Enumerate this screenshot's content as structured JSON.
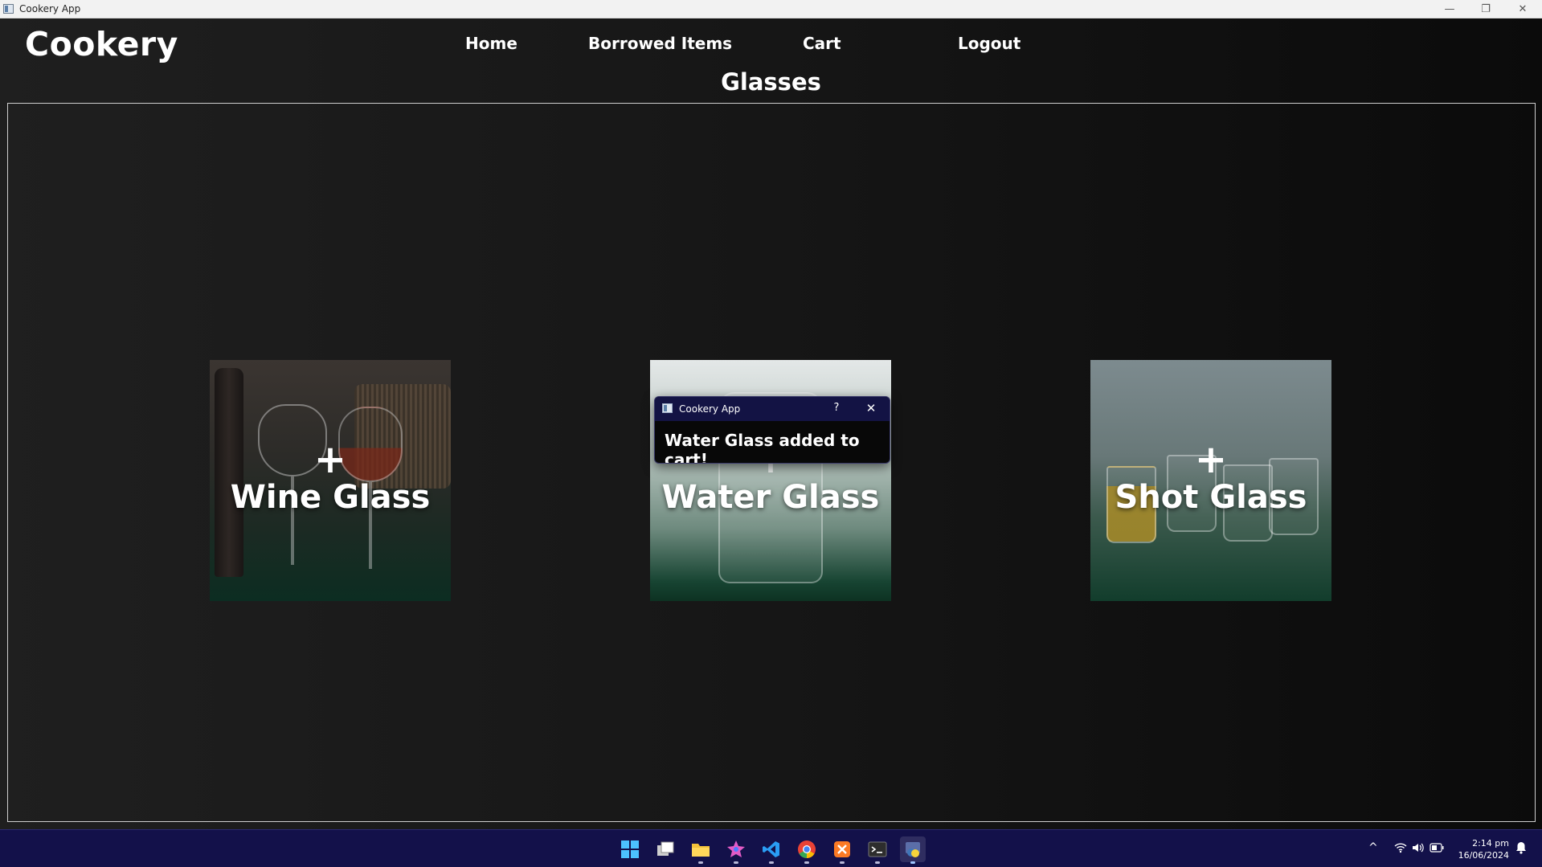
{
  "window": {
    "title": "Cookery App",
    "minimize_glyph": "—",
    "restore_glyph": "❐",
    "close_glyph": "✕"
  },
  "header": {
    "brand": "Cookery",
    "nav": {
      "home": "Home",
      "borrowed": "Borrowed Items",
      "cart": "Cart",
      "logout": "Logout"
    },
    "page_title": "Glasses"
  },
  "cards": [
    {
      "plus": "+",
      "label": "Wine Glass"
    },
    {
      "plus": "+",
      "label": "Water Glass"
    },
    {
      "plus": "+",
      "label": "Shot Glass"
    }
  ],
  "dialog": {
    "title": "Cookery App",
    "help": "?",
    "close": "✕",
    "message": "Water Glass added to cart!"
  },
  "taskbar": {
    "icons": [
      "windows-start-icon",
      "task-view-icon",
      "file-explorer-icon",
      "paint-app-icon",
      "vscode-icon",
      "chrome-icon",
      "xampp-icon",
      "terminal-icon",
      "python-app-icon"
    ],
    "tray_chevron": "^",
    "time": "2:14 pm",
    "date": "16/06/2024"
  },
  "colors": {
    "taskbar_bg": "#13114a",
    "dialog_titlebar": "#131344",
    "app_bg_dark": "#0f0f0f"
  }
}
